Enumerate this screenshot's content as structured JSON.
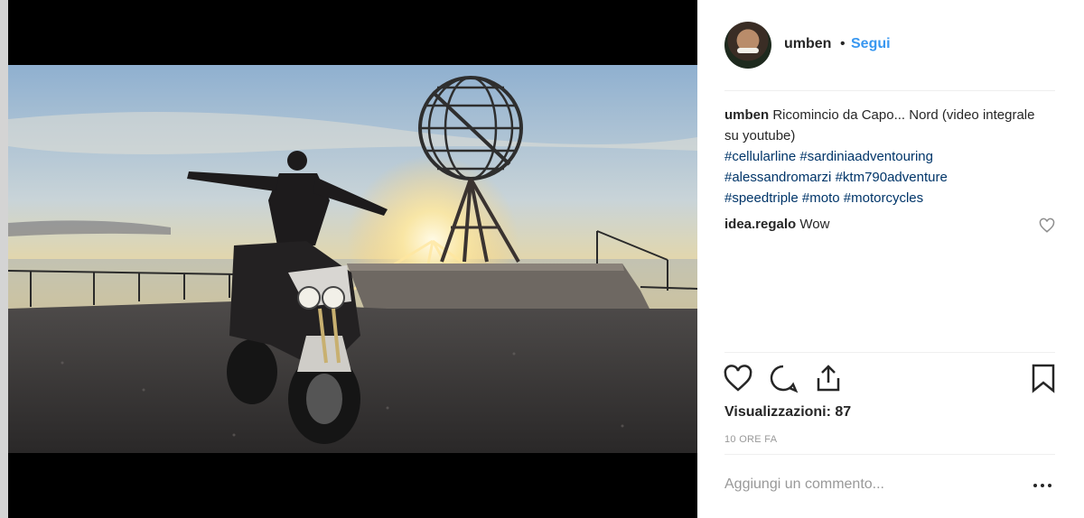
{
  "post": {
    "username": "umben",
    "separator": "•",
    "follow_label": "Segui"
  },
  "caption": {
    "author": "umben",
    "text": "Ricomincio da Capo... Nord (video integrale su youtube)",
    "hashtags": [
      "#cellularline",
      "#sardiniaadventouring",
      "#alessandromarzi",
      "#ktm790adventure",
      "#speedtriple",
      "#moto",
      "#motorcycles"
    ]
  },
  "comments": [
    {
      "author": "idea.regalo",
      "text": "Wow"
    }
  ],
  "actions": {
    "like_icon": "heart-icon",
    "comment_icon": "comment-icon",
    "share_icon": "share-icon",
    "save_icon": "bookmark-icon"
  },
  "stats": {
    "views": "Visualizzazioni: 87",
    "time": "10 ORE FA"
  },
  "composer": {
    "placeholder": "Aggiungi un commento...",
    "more_icon": "more-icon"
  },
  "colors": {
    "accent": "#3897f0",
    "hashtag": "#003569",
    "text": "#262626",
    "muted": "#999999"
  }
}
